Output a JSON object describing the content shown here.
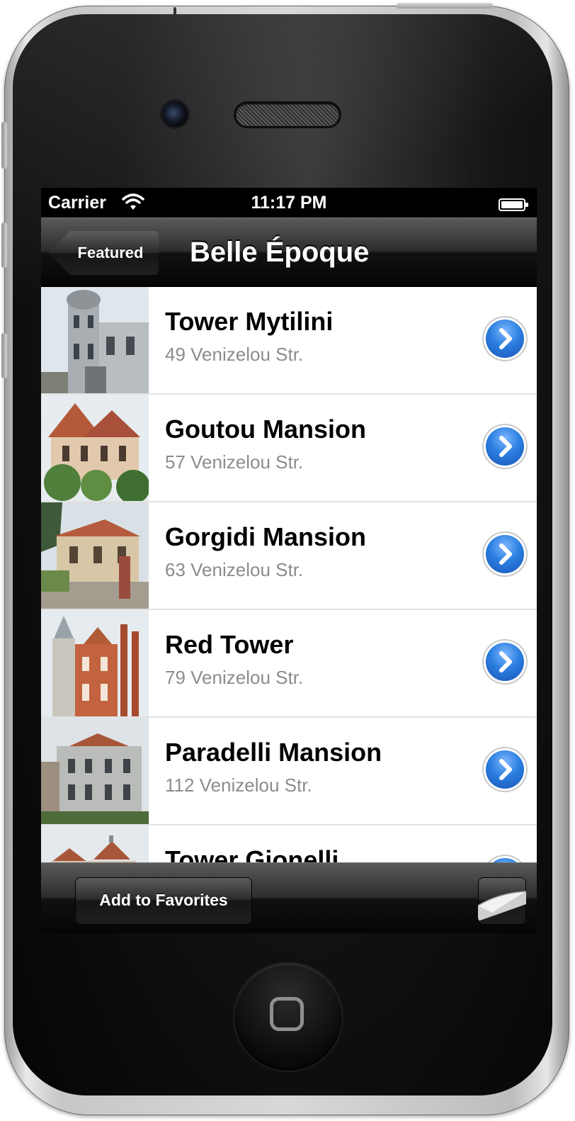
{
  "status_bar": {
    "carrier": "Carrier",
    "time": "11:17 PM",
    "wifi_icon": "wifi-icon",
    "battery_icon": "battery-icon"
  },
  "nav_bar": {
    "back_label": "Featured",
    "title": "Belle Époque"
  },
  "places": [
    {
      "name": "Tower Mytilini",
      "address": "49 Venizelou Str.",
      "thumbnail": "photo of grey stone tower mansion"
    },
    {
      "name": "Goutou Mansion",
      "address": "57 Venizelou Str.",
      "thumbnail": "photo of red-roofed mansion with trees"
    },
    {
      "name": "Gorgidi Mansion",
      "address": "63 Venizelou Str.",
      "thumbnail": "photo of mansion behind garden wall"
    },
    {
      "name": "Red Tower",
      "address": "79 Venizelou Str.",
      "thumbnail": "photo of red brick towered building"
    },
    {
      "name": "Paradelli Mansion",
      "address": "112 Venizelou Str.",
      "thumbnail": "photo of grey stone mansion"
    },
    {
      "name": "Tower Gionelli",
      "address": "",
      "thumbnail": "photo of pointed-roof building"
    }
  ],
  "toolbar": {
    "favorites_label": "Add to Favorites",
    "page_curl_icon": "page-curl-icon"
  },
  "colors": {
    "accent_blue": "#2b7fe0",
    "subtitle_gray": "#8c8c8c"
  }
}
